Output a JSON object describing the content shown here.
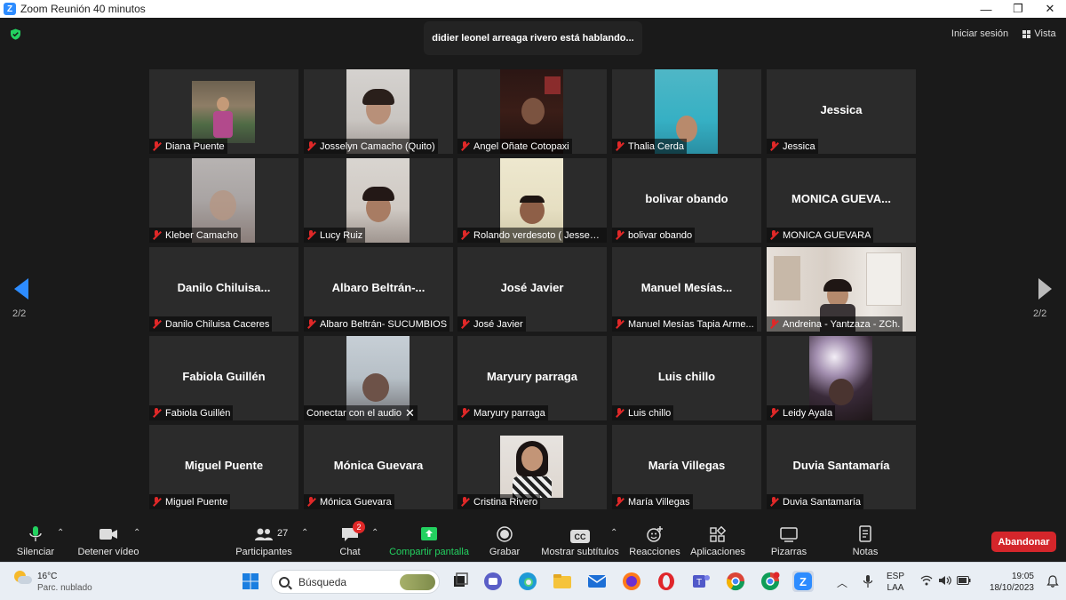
{
  "window": {
    "title": "Zoom Reunión 40 minutos",
    "controls": [
      "—",
      "❐",
      "✕"
    ]
  },
  "header": {
    "speaking_banner": "didier leonel arreaga rivero está hablando...",
    "login_label": "Iniciar sesión",
    "view_label": "Vista"
  },
  "pagination": {
    "left": "2/2",
    "right": "2/2"
  },
  "tiles": [
    {
      "big": "",
      "name": "Diana Puente"
    },
    {
      "big": "",
      "name": "Josselyn Camacho (Quito)"
    },
    {
      "big": "",
      "name": "Angel Oñate Cotopaxi"
    },
    {
      "big": "",
      "name": "Thalia Cerda"
    },
    {
      "big": "Jessica",
      "name": "Jessica"
    },
    {
      "big": "",
      "name": "Kleber Camacho"
    },
    {
      "big": "",
      "name": "Lucy Ruiz"
    },
    {
      "big": "",
      "name": "Rolando verdesoto  ( Jessenia..."
    },
    {
      "big": "bolivar obando",
      "name": "bolivar obando"
    },
    {
      "big": "MONICA  GUEVA...",
      "name": "MONICA GUEVARA"
    },
    {
      "big": "Danilo  Chiluisa...",
      "name": "Danilo Chiluisa Caceres"
    },
    {
      "big": "Albaro  Beltrán-...",
      "name": "Albaro Beltrán- SUCUMBIOS"
    },
    {
      "big": "José Javier",
      "name": "José Javier"
    },
    {
      "big": "Manuel  Mesías...",
      "name": "Manuel Mesías Tapia Arme..."
    },
    {
      "big": "",
      "name": "Andreina - Yantzaza - ZCh."
    },
    {
      "big": "Fabiola Guillén",
      "name": "Fabiola Guillén"
    },
    {
      "big": "",
      "name": "Conectar con el audio"
    },
    {
      "big": "Maryury parraga",
      "name": "Maryury parraga"
    },
    {
      "big": "Luis chillo",
      "name": "Luis chillo"
    },
    {
      "big": "",
      "name": "Leidy Ayala"
    },
    {
      "big": "Miguel Puente",
      "name": "Miguel Puente"
    },
    {
      "big": "Mónica Guevara",
      "name": "Mónica Guevara"
    },
    {
      "big": "",
      "name": "Cristina Rivero"
    },
    {
      "big": "María Villegas",
      "name": "María Villegas"
    },
    {
      "big": "Duvia Santamaría",
      "name": "Duvia Santamaría"
    }
  ],
  "toolbar": {
    "mute": "Silenciar",
    "stop_video": "Detener vídeo",
    "participants": "Participantes",
    "participants_count": "27",
    "chat": "Chat",
    "chat_badge": "2",
    "share": "Compartir pantalla",
    "record": "Grabar",
    "subtitles": "Mostrar subtítulos",
    "subtitles_icon": "CC",
    "reactions": "Reacciones",
    "apps": "Aplicaciones",
    "whiteboards": "Pizarras",
    "notes": "Notas",
    "leave": "Abandonar"
  },
  "taskbar": {
    "temperature": "16°C",
    "weather": "Parc. nublado",
    "search_placeholder": "Búsqueda",
    "lang_top": "ESP",
    "lang_bottom": "LAA",
    "time": "19:05",
    "date": "18/10/2023"
  },
  "colors": {
    "zoom_blue": "#2d8cff",
    "leave_red": "#d4262b",
    "share_green": "#23d160",
    "muted_red": "#e02828"
  }
}
